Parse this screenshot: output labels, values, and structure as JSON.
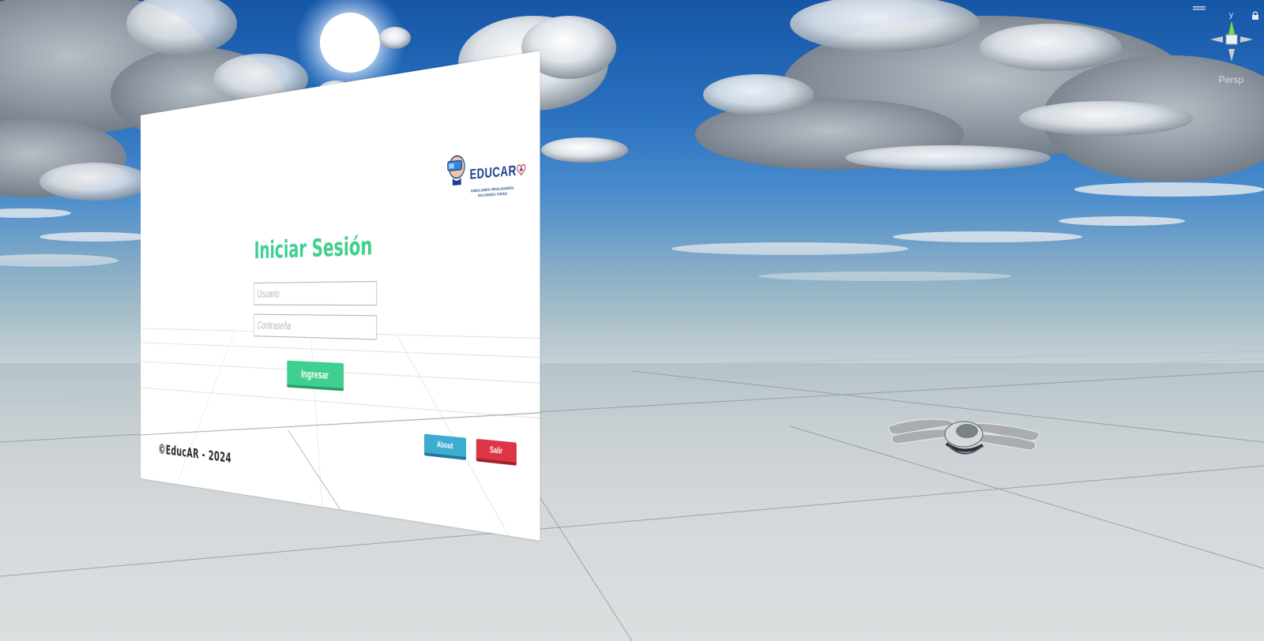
{
  "login": {
    "title": "Iniciar Sesión",
    "username_placeholder": "Usuario",
    "password_placeholder": "Contraseña",
    "submit_label": "Ingresar",
    "about_label": "About",
    "exit_label": "Salir",
    "copyright": "©EducAR - 2024"
  },
  "logo": {
    "name": "EDUCAR",
    "tagline": "SIMULANDO REALIDADES, SALVANDO VIDAS"
  },
  "gizmo": {
    "axis_label": "y",
    "view_label": "Persp"
  },
  "colors": {
    "title": "#3fcf8e",
    "submit": "#3fcf8e",
    "about": "#3cacd0",
    "exit": "#dc3545",
    "logo": "#1c3f8c"
  },
  "icons": [
    "educar-logo-icon",
    "lock-icon",
    "menu-icon",
    "scene-gizmo-icon",
    "vr-hands-icon"
  ]
}
